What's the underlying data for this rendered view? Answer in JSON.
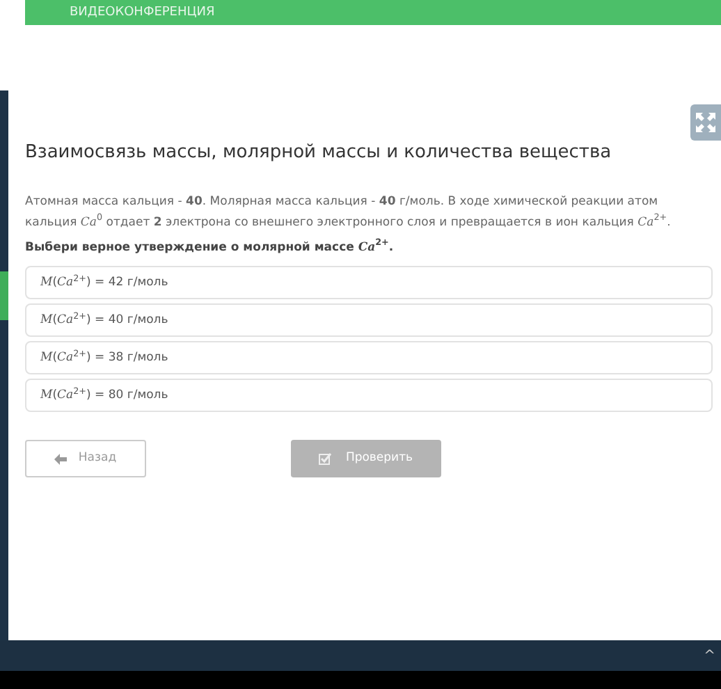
{
  "banner": {
    "label": "ВИДЕОКОНФЕРЕНЦИЯ"
  },
  "title": "Взаимосвязь массы, молярной массы и количества вещества",
  "text": "Атомная масса кальция - **40**. Молярная масса кальция - **40** г/моль. В ходе химической реакции атом кальция *Ca*$^{0}$ отдает **2** электрона со внешнего электронного слоя и превращается в ион кальция *Ca*$^{2+}$.",
  "question": "Выбери верное утверждение о молярной массе *Ca*$^{2+}$.",
  "options": [
    {
      "text": "*M*(*Ca*$^{2+}$) = 42 г/моль",
      "selected": false
    },
    {
      "text": "*M*(*Ca*$^{2+}$) = 40 г/моль",
      "selected": false
    },
    {
      "text": "*M*(*Ca*$^{2+}$) = 38 г/моль",
      "selected": false
    },
    {
      "text": "*M*(*Ca*$^{2+}$) = 80 г/моль",
      "selected": false
    }
  ],
  "back_button": {
    "label": "Назад"
  },
  "check_button": {
    "label": "Проверить",
    "disabled": true
  },
  "taskbar": {
    "tray_arrow": "^"
  }
}
